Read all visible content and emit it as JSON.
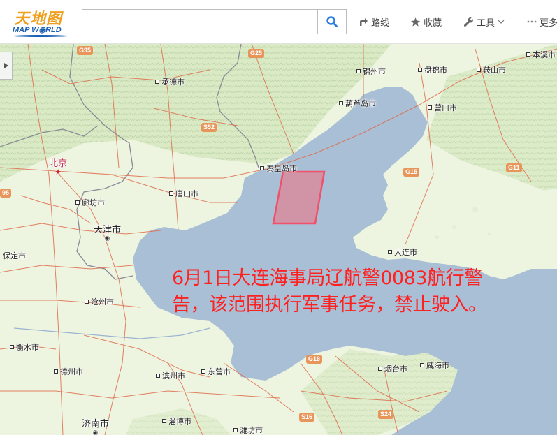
{
  "app": {
    "logo_cn": "天地图",
    "logo_en": "MAP W◉RLD"
  },
  "search": {
    "value": "",
    "placeholder": "",
    "button_icon": "search-icon"
  },
  "nav": [
    {
      "label": "路线",
      "icon": "route-icon"
    },
    {
      "label": "收藏",
      "icon": "star-icon"
    },
    {
      "label": "工具",
      "icon": "wrench-icon",
      "dropdown": true
    },
    {
      "label": "更多",
      "icon": "more-icon"
    }
  ],
  "map": {
    "panel_toggle_icon": "expand-arrow-icon",
    "cities": [
      {
        "name": "承德市"
      },
      {
        "name": "锦州市"
      },
      {
        "name": "盘锦市"
      },
      {
        "name": "鞍山市"
      },
      {
        "name": "本溪市"
      },
      {
        "name": "葫芦岛市"
      },
      {
        "name": "营口市"
      },
      {
        "name": "北京"
      },
      {
        "name": "秦皇岛市"
      },
      {
        "name": "唐山市"
      },
      {
        "name": "廊坊市"
      },
      {
        "name": "天津市"
      },
      {
        "name": "保定市"
      },
      {
        "name": "大连市"
      },
      {
        "name": "沧州市"
      },
      {
        "name": "衡水市"
      },
      {
        "name": "德州市"
      },
      {
        "name": "滨州市"
      },
      {
        "name": "东营市"
      },
      {
        "name": "烟台市"
      },
      {
        "name": "威海市"
      },
      {
        "name": "济南市"
      },
      {
        "name": "淄博市"
      },
      {
        "name": "潍坊市"
      }
    ],
    "highways": [
      "G95",
      "G25",
      "S52",
      "G15",
      "G11",
      "95",
      "G18",
      "S16",
      "S24"
    ],
    "restricted_zone": {
      "label": "navigation warning area",
      "fill": "#d98a9a",
      "stroke": "#f0506a"
    },
    "notice": {
      "line1": "6月1日大连海事局辽航警0083航行警",
      "line2": "告，该范围执行军事任务，禁止驶入。",
      "color": "#ff2020"
    }
  }
}
